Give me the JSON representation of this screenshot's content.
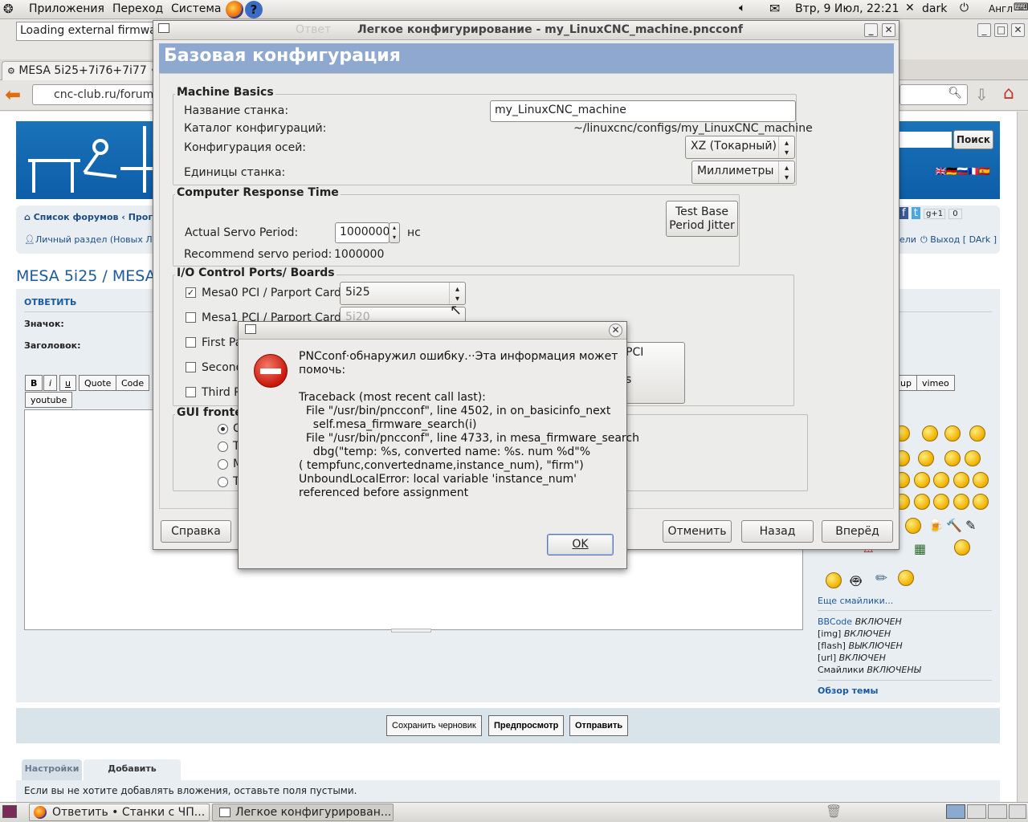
{
  "top_panel": {
    "menu_apps": "Приложения",
    "menu_places": "Переход",
    "menu_system": "Система",
    "clock": "Втр,  9 Июл, 22:21",
    "user": "dark",
    "keyboard_layout": "Англ"
  },
  "browser": {
    "notification": "Loading external firmware",
    "tab_title": "MESA 5i25+7i76+7i77 • С",
    "url": "cnc-club.ru/forum/p",
    "page": {
      "search_button": "Поиск",
      "breadcrumb_forums": "Список форумов",
      "breadcrumb_section": "Програ",
      "personal_section": "Личный раздел (Новых ЛС:",
      "logout": "Выход [ DArk ]",
      "users_link": "ели",
      "page_title": "MESA 5i25 / MESA",
      "reply_label": "ОТВЕТИТЬ",
      "icon_label": "Значок:",
      "subject_label": "Заголовок:",
      "toolbar": {
        "bold": "B",
        "italic": "i",
        "underline": "u",
        "quote": "Quote",
        "code": "Code",
        "youtube": "youtube",
        "vimeo": "vimeo",
        "up": "up"
      },
      "more_smileys": "Еще смайлики...",
      "bbcode_status": [
        {
          "name": "BBCode",
          "state": "ВКЛЮЧЕН"
        },
        {
          "name": "[img]",
          "state": "ВКЛЮЧЕН"
        },
        {
          "name": "[flash]",
          "state": "ВЫКЛЮЧЕН"
        },
        {
          "name": "[url]",
          "state": "ВКЛЮЧЕН"
        },
        {
          "name": "Смайлики",
          "state": "ВКЛЮЧЕНЫ"
        }
      ],
      "topic_overview": "Обзор темы",
      "save_draft": "Сохранить черновик",
      "preview": "Предпросмотр",
      "send": "Отправить",
      "tab_settings": "Настройки",
      "tab_attachments": "Добавить вложения",
      "attachments_hint": "Если вы не хотите добавлять вложения, оставьте поля пустыми.",
      "share_count": "0"
    }
  },
  "main_window": {
    "title": "Легкое конфигурирование - my_LinuxCNC_machine.pncconf",
    "title_prefix": "Ответ",
    "banner": "Базовая конфигурация",
    "machine_basics": {
      "heading": "Machine Basics",
      "name_label": "Название станка:",
      "name_value": "my_LinuxCNC_machine",
      "dir_label": "Каталог конфигураций:",
      "dir_value": "~/linuxcnc/configs/my_LinuxCNC_machine",
      "axis_label": "Конфигурация осей:",
      "axis_value": "XZ (Токарный)",
      "units_label": "Единицы станка:",
      "units_value": "Миллиметры"
    },
    "response_time": {
      "heading": "Computer Response Time",
      "servo_label": "Actual Servo Period:",
      "servo_value": "1000000",
      "servo_unit": "нс",
      "recommend_label": "Recommend servo period:",
      "recommend_value": "1000000",
      "test_button_line1": "Test Base",
      "test_button_line2": "Period Jitter"
    },
    "io_ports": {
      "heading": "I/O Control Ports/ Boards",
      "mesa0_label": "Mesa0 PCI / Parport Card:",
      "mesa0_value": "5i25",
      "mesa0_checked": true,
      "mesa1_label": "Mesa1 PCI / Parport Card:",
      "mesa1_value": "5i20",
      "first_label": "First Pa",
      "second_label": "Second",
      "third_label": "Third P",
      "pci_fragment": "PCI",
      "s_fragment": "s"
    },
    "gui": {
      "heading": "GUI fronte",
      "options": [
        "C",
        "T",
        "M",
        "T"
      ]
    },
    "buttons": {
      "help": "Справка",
      "cancel": "Отменить",
      "back": "Назад",
      "forward": "Вперёд"
    }
  },
  "error_dialog": {
    "message_line1": "PNCconf·обнаружил ошибку.··Эта информация может",
    "message_line2": "помочь:",
    "traceback": "Traceback (most recent call last):\n  File \"/usr/bin/pncconf\", line 4502, in on_basicinfo_next\n    self.mesa_firmware_search(i)\n  File \"/usr/bin/pncconf\", line 4733, in mesa_firmware_search\n    dbg(\"temp: %s, converted name: %s. num %d\"%\n( tempfunc,convertedname,instance_num), \"firm\")\nUnboundLocalError: local variable 'instance_num'\nreferenced before assignment",
    "ok": "OK"
  },
  "taskbar": {
    "task1": "Ответить • Станки с ЧП...",
    "task2": "Легкое конфигурирован..."
  }
}
